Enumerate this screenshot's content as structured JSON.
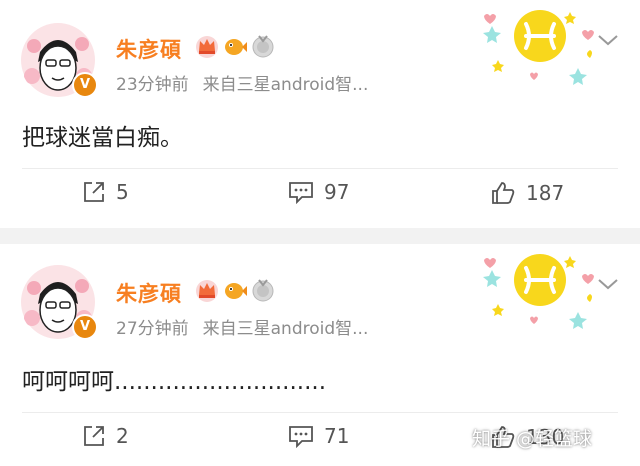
{
  "posts": [
    {
      "author": "朱彦碩",
      "time": "23分钟前",
      "source": "来自三星android智...",
      "content": "把球迷當白痴。",
      "reposts": "5",
      "comments": "97",
      "likes": "187"
    },
    {
      "author": "朱彦碩",
      "time": "27分钟前",
      "source": "来自三星android智...",
      "content": "呵呵呵呵.............................",
      "reposts": "2",
      "comments": "71",
      "likes": "130"
    }
  ],
  "watermark": "知乎 @轻篮球",
  "colors": {
    "author_name": "#f77f21",
    "meta_text": "#8c8c8c",
    "verified_badge": "#e8870e",
    "separator": "#f2f2f2"
  },
  "icons": [
    "crown-vip-icon",
    "goldfish-icon",
    "medal-icon",
    "pisces-sticker",
    "chevron-down-icon",
    "repost-icon",
    "comment-icon",
    "like-icon"
  ]
}
